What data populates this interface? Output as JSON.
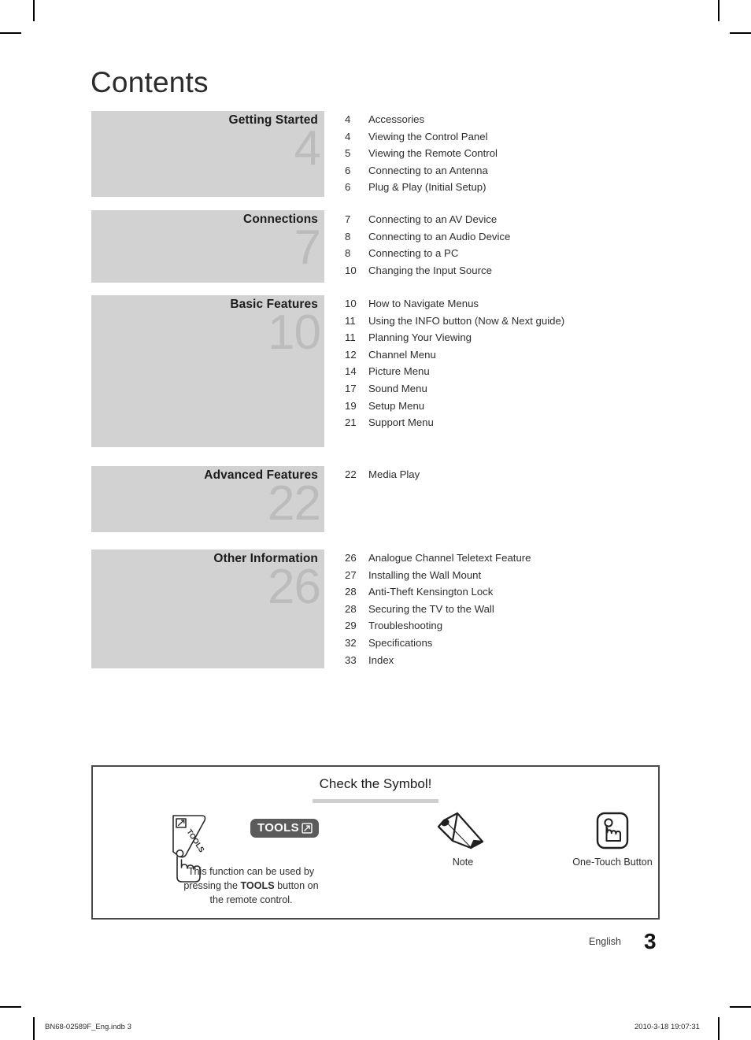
{
  "page": {
    "title": "Contents",
    "language_label": "English",
    "folio": "3",
    "print_code": "BN68-02589F_Eng.indb   3",
    "print_timestamp": "2010-3-18   19:07:31"
  },
  "colors": {
    "band_background": "#d2d2d2",
    "band_number": "#bcbcbc",
    "text": "#2e2e2e",
    "box_border": "#4a4a4a",
    "badge_background": "#5b5b5b",
    "heading_underline": "#cfcfcf"
  },
  "contents": [
    {
      "title": "Getting Started",
      "start_page": "4",
      "entries": [
        {
          "page": "4",
          "name": "Accessories"
        },
        {
          "page": "4",
          "name": "Viewing the Control Panel"
        },
        {
          "page": "5",
          "name": "Viewing the Remote Control"
        },
        {
          "page": "6",
          "name": "Connecting to an Antenna"
        },
        {
          "page": "6",
          "name": "Plug & Play (Initial Setup)"
        }
      ]
    },
    {
      "title": "Connections",
      "start_page": "7",
      "entries": [
        {
          "page": "7",
          "name": "Connecting to an AV Device"
        },
        {
          "page": "8",
          "name": "Connecting to an Audio Device"
        },
        {
          "page": "8",
          "name": "Connecting to a PC"
        },
        {
          "page": "10",
          "name": "Changing the Input Source"
        }
      ]
    },
    {
      "title": "Basic Features",
      "start_page": "10",
      "entries": [
        {
          "page": "10",
          "name": "How to Navigate Menus"
        },
        {
          "page": "11",
          "name": "Using the INFO button (Now & Next guide)"
        },
        {
          "page": "11",
          "name": "Planning Your Viewing"
        },
        {
          "page": "12",
          "name": "Channel Menu"
        },
        {
          "page": "14",
          "name": "Picture Menu"
        },
        {
          "page": "17",
          "name": "Sound Menu"
        },
        {
          "page": "19",
          "name": "Setup Menu"
        },
        {
          "page": "21",
          "name": "Support Menu"
        }
      ]
    },
    {
      "title": "Advanced Features",
      "start_page": "22",
      "entries": [
        {
          "page": "22",
          "name": "Media Play"
        }
      ]
    },
    {
      "title": "Other Information",
      "start_page": "26",
      "entries": [
        {
          "page": "26",
          "name": "Analogue Channel Teletext Feature"
        },
        {
          "page": "27",
          "name": "Installing the Wall Mount"
        },
        {
          "page": "28",
          "name": "Anti-Theft Kensington Lock"
        },
        {
          "page": "28",
          "name": "Securing the TV to the Wall"
        },
        {
          "page": "29",
          "name": "Troubleshooting"
        },
        {
          "page": "32",
          "name": "Specifications"
        },
        {
          "page": "33",
          "name": "Index"
        }
      ]
    }
  ],
  "symbol_box": {
    "heading": "Check the Symbol!",
    "tools": {
      "badge_label": "TOOLS",
      "caption_line1": "This function can be used by",
      "caption_line2_pre": "pressing the ",
      "caption_line2_bold": "TOOLS",
      "caption_line2_post": " button on",
      "caption_line3": "the remote control."
    },
    "note": {
      "caption": "Note"
    },
    "one_touch": {
      "caption": "One-Touch Button"
    }
  }
}
